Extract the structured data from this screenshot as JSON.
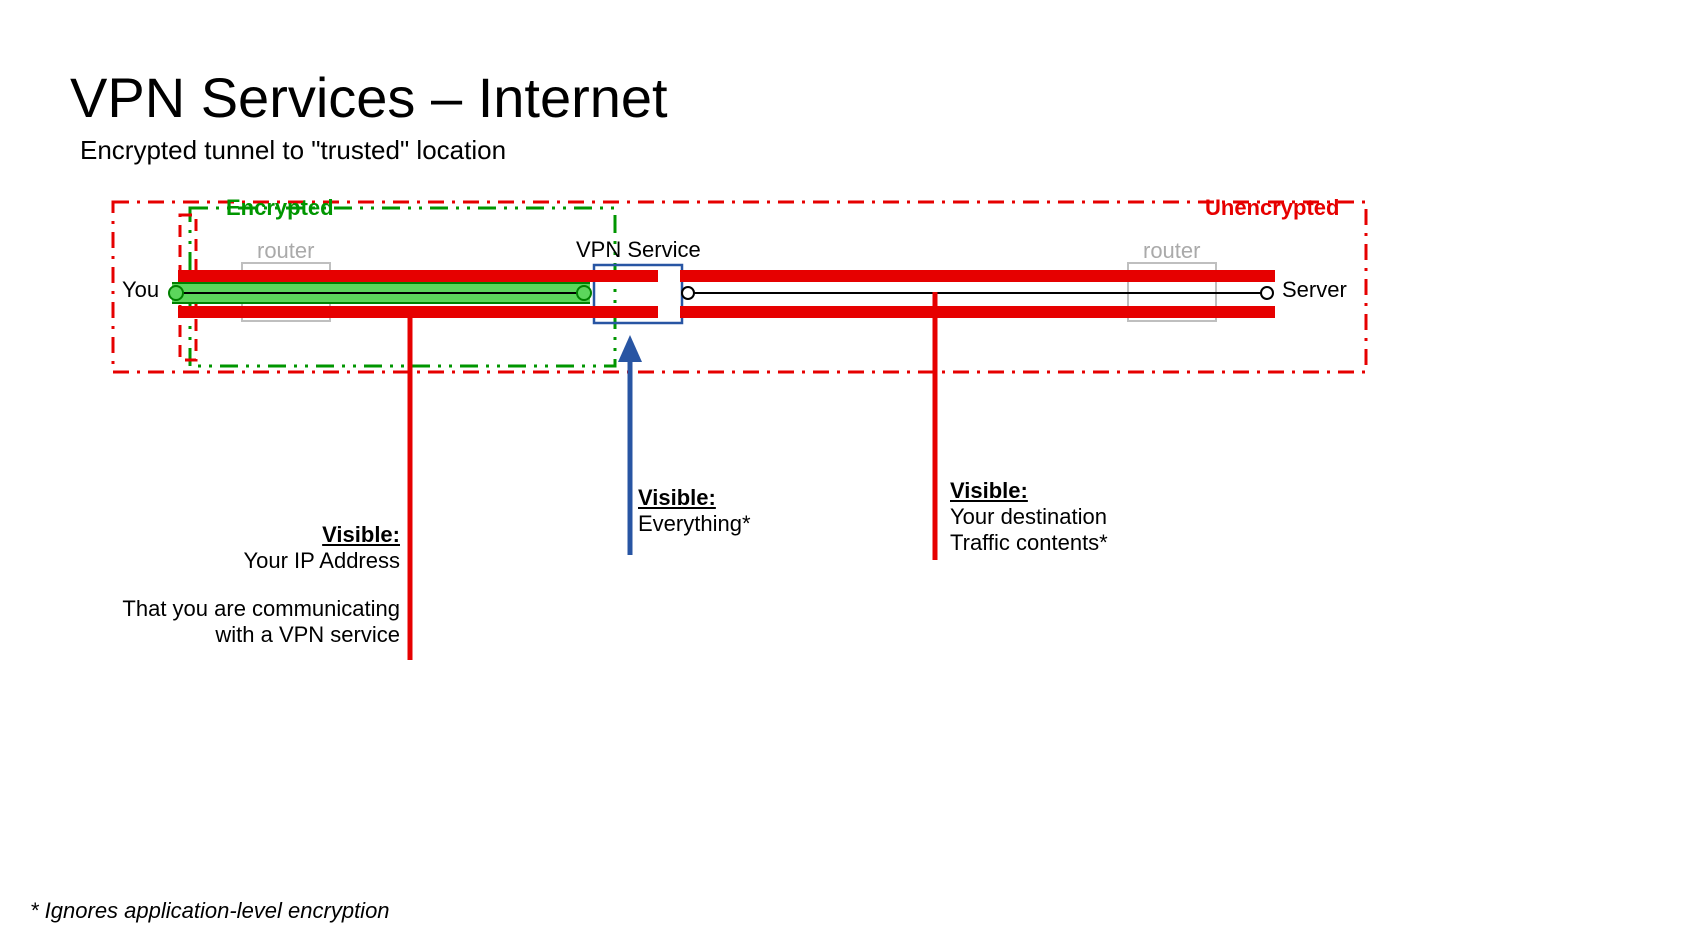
{
  "title": "VPN Services – Internet",
  "subtitle": "Encrypted tunnel to \"trusted\" location",
  "labels": {
    "you": "You",
    "server": "Server",
    "router1": "router",
    "router2": "router",
    "vpn_service": "VPN Service",
    "encrypted": "Encrypted",
    "unencrypted": "Unencrypted"
  },
  "callouts": {
    "left": {
      "header": "Visible:",
      "line1": "Your IP Address",
      "line2": "That you are communicating",
      "line3": "with a VPN service"
    },
    "middle": {
      "header": "Visible:",
      "line1": "Everything*"
    },
    "right": {
      "header": "Visible:",
      "line1": "Your destination",
      "line2": "Traffic contents*"
    }
  },
  "footnote": "* Ignores application-level encryption",
  "colors": {
    "green": "#00a000",
    "green_fill": "#5cd65c",
    "red": "#e60000",
    "blue": "#2855a3",
    "grey": "#bfbfbf"
  }
}
